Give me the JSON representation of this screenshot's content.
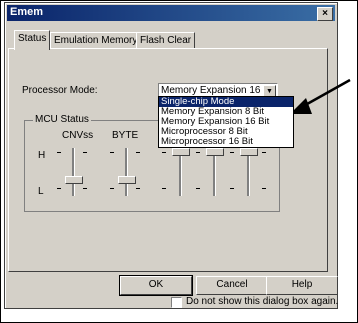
{
  "window": {
    "title": "Emem",
    "close_label": "×"
  },
  "tabs": [
    {
      "label": "Status",
      "active": true
    },
    {
      "label": "Emulation Memory",
      "active": false
    },
    {
      "label": "Flash Clear",
      "active": false
    }
  ],
  "processor_mode": {
    "label": "Processor Mode:",
    "selected_value": "Memory Expansion 16 Bit",
    "options": [
      "Single-chip Mode",
      "Memory Expansion 8 Bit",
      "Memory Expansion 16 Bit",
      "Microprocessor 8 Bit",
      "Microprocessor 16 Bit"
    ],
    "highlighted_index": 0
  },
  "mcu_status": {
    "group_label": "MCU Status",
    "columns": [
      "CNVss",
      "BYTE"
    ],
    "h_label": "H",
    "l_label": "L"
  },
  "buttons": {
    "ok": "OK",
    "cancel": "Cancel",
    "help": "Help"
  },
  "checkbox": {
    "label": "Do not show this dialog box again.",
    "checked": false
  },
  "colors": {
    "titlebar": "#0a246a",
    "face": "#d4d0c8",
    "highlight": "#0a246a"
  }
}
